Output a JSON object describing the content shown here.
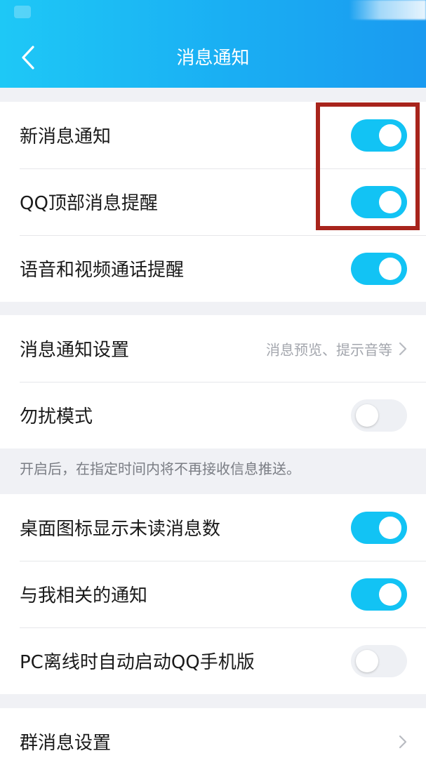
{
  "header": {
    "title": "消息通知",
    "back_icon": "chevron-left-icon",
    "gradient_colors": [
      "#1ec8f6",
      "#1a9af0"
    ]
  },
  "groups": [
    {
      "rows": [
        {
          "label": "新消息通知",
          "toggle": true
        },
        {
          "label": "QQ顶部消息提醒",
          "toggle": true
        },
        {
          "label": "语音和视频通话提醒",
          "toggle": true
        }
      ]
    },
    {
      "rows": [
        {
          "label": "消息通知设置",
          "value": "消息预览、提示音等",
          "icon": "chevron-right-icon"
        },
        {
          "label": "勿扰模式",
          "toggle": false
        }
      ]
    },
    {
      "hint": "开启后，在指定时间内将不再接收信息推送。"
    },
    {
      "rows": [
        {
          "label": "桌面图标显示未读消息数",
          "toggle": true
        },
        {
          "label": "与我相关的通知",
          "toggle": true
        },
        {
          "label": "PC离线时自动启动QQ手机版",
          "toggle": false
        }
      ]
    },
    {
      "rows": [
        {
          "label": "群消息设置",
          "icon": "chevron-right-icon"
        }
      ]
    }
  ],
  "colors": {
    "toggle_on": "#12c3f4",
    "toggle_off": "#eef0f4",
    "highlight": "#a8241c",
    "background": "#f0f1f5"
  }
}
